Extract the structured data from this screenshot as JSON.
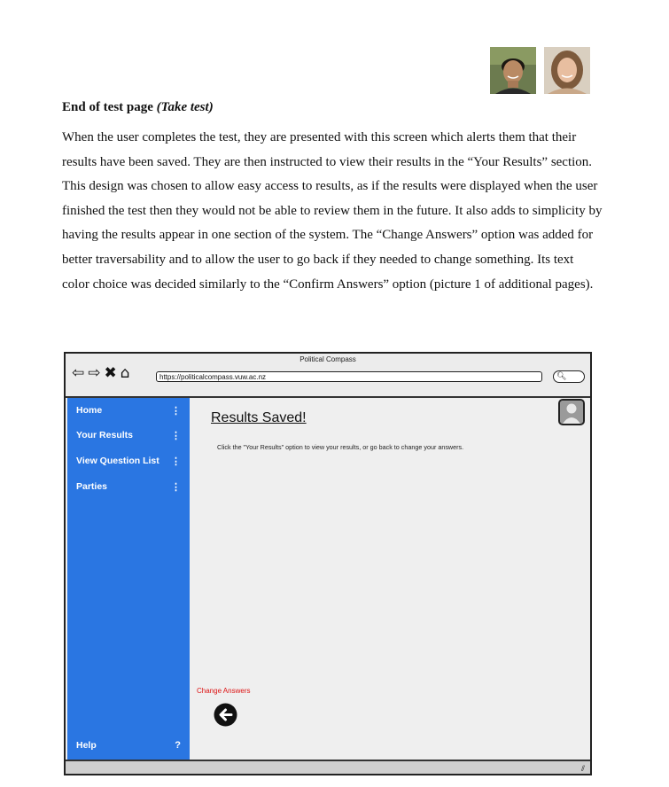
{
  "doc": {
    "heading_bold": "End of test page ",
    "heading_italic": "(Take test)",
    "paragraph": "When the user completes the test, they are presented with this screen which alerts them that their results have been saved. They are then instructed to view their results in the “Your Results” section. This design was chosen to allow easy access to results, as if the results were displayed when the user finished the test then they would not be able to review them in the future. It also adds to simplicity by having the results appear in one section of the system. The “Change Answers” option was added for better traversability and to allow the user to go back if they needed to change something. Its text color choice was decided similarly to the “Confirm Answers” option (picture 1 of additional pages)."
  },
  "mockup": {
    "window_title": "Political Compass",
    "url": "https://politicalcompass.vuw.ac.nz",
    "nav_icons": [
      "back-arrow-icon",
      "forward-arrow-icon",
      "close-icon",
      "home-icon"
    ],
    "sidebar": {
      "items": [
        {
          "label": "Home",
          "marker": "⋮"
        },
        {
          "label": "Your Results",
          "marker": "⋮"
        },
        {
          "label": "View Question List",
          "marker": "⋮"
        },
        {
          "label": "Parties",
          "marker": "⋮"
        }
      ],
      "help": {
        "label": "Help",
        "marker": "?"
      }
    },
    "main": {
      "title": "Results Saved!",
      "message": "Click the \"Your Results\" option to view your results, or go back to change your answers.",
      "change_answers": "Change Answers"
    }
  },
  "colors": {
    "sidebar": "#2a76e2",
    "link_red": "#dd1111",
    "frame": "#222222"
  }
}
